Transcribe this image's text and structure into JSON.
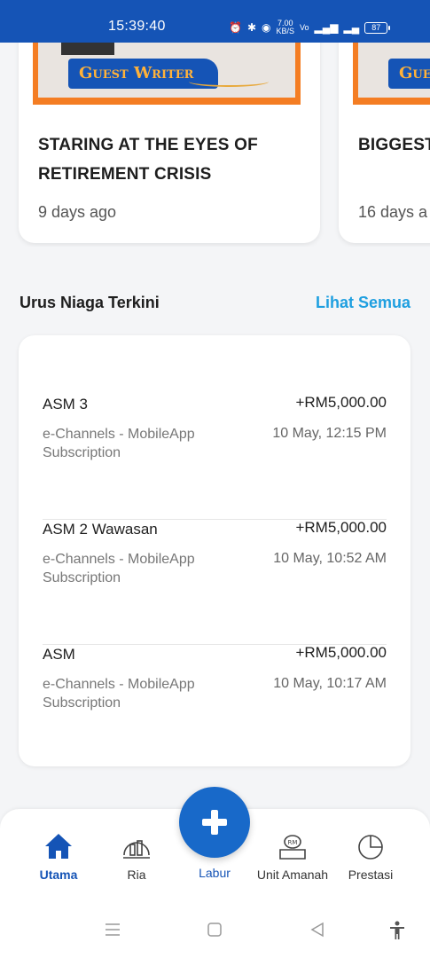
{
  "status_bar": {
    "time": "15:39:40",
    "network_speed": "7.00",
    "network_speed_unit": "KB/S",
    "battery": "87"
  },
  "news": [
    {
      "banner_label": "Guest Writer",
      "title": "STARING AT THE EYES OF RETIREMENT CRISIS",
      "age": "9 days ago"
    },
    {
      "banner_label": "Guest",
      "title": "BIGGEST INVESTIN",
      "age": "16 days a"
    }
  ],
  "transactions_section": {
    "title": "Urus Niaga Terkini",
    "view_all": "Lihat Semua"
  },
  "transactions": [
    {
      "name": "ASM 3",
      "amount": "+RM5,000.00",
      "description": "e-Channels - MobileApp Subscription",
      "date": "10 May, 12:15 PM"
    },
    {
      "name": "ASM 2 Wawasan",
      "amount": "+RM5,000.00",
      "description": "e-Channels - MobileApp Subscription",
      "date": "10 May, 10:52 AM"
    },
    {
      "name": "ASM",
      "amount": "+RM5,000.00",
      "description": "e-Channels - MobileApp Subscription",
      "date": "10 May, 10:17 AM"
    }
  ],
  "bottom_nav": {
    "home": "Utama",
    "ria": "Ria",
    "labur": "Labur",
    "unit_amanah": "Unit Amanah",
    "prestasi": "Prestasi"
  },
  "colors": {
    "primary": "#1554b6",
    "accent_orange": "#f47d23",
    "link": "#1e9fe0"
  }
}
